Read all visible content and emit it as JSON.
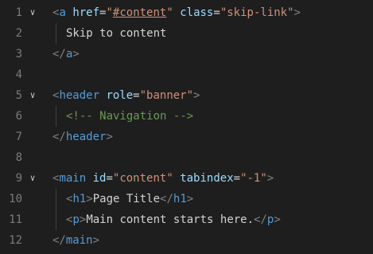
{
  "editor": {
    "colors": {
      "background": "#1e1e1e",
      "line_number": "#7b7b7b",
      "bracket": "#808080",
      "tag": "#569cd6",
      "attribute": "#9cdcfe",
      "string": "#ce9178",
      "text": "#d4d4d4",
      "comment": "#6a9955"
    },
    "fold_icon": "chevron-down-icon",
    "lines": [
      {
        "number": "1",
        "fold": "∨",
        "indent": 0,
        "tokens": [
          {
            "type": "bracket",
            "text": "<"
          },
          {
            "type": "tag",
            "text": "a"
          },
          {
            "type": "text",
            "text": " "
          },
          {
            "type": "attr",
            "text": "href"
          },
          {
            "type": "eq",
            "text": "="
          },
          {
            "type": "str",
            "text": "\""
          },
          {
            "type": "str_underline",
            "text": "#content"
          },
          {
            "type": "str",
            "text": "\""
          },
          {
            "type": "text",
            "text": " "
          },
          {
            "type": "attr",
            "text": "class"
          },
          {
            "type": "eq",
            "text": "="
          },
          {
            "type": "str",
            "text": "\"skip-link\""
          },
          {
            "type": "bracket",
            "text": ">"
          }
        ]
      },
      {
        "number": "2",
        "fold": "",
        "indent": 1,
        "tokens": [
          {
            "type": "text",
            "text": "Skip to content"
          }
        ]
      },
      {
        "number": "3",
        "fold": "",
        "indent": 0,
        "tokens": [
          {
            "type": "bracket",
            "text": "</"
          },
          {
            "type": "tag",
            "text": "a"
          },
          {
            "type": "bracket",
            "text": ">"
          }
        ]
      },
      {
        "number": "4",
        "fold": "",
        "indent": 0,
        "tokens": []
      },
      {
        "number": "5",
        "fold": "∨",
        "indent": 0,
        "tokens": [
          {
            "type": "bracket",
            "text": "<"
          },
          {
            "type": "tag",
            "text": "header"
          },
          {
            "type": "text",
            "text": " "
          },
          {
            "type": "attr",
            "text": "role"
          },
          {
            "type": "eq",
            "text": "="
          },
          {
            "type": "str",
            "text": "\"banner\""
          },
          {
            "type": "bracket",
            "text": ">"
          }
        ]
      },
      {
        "number": "6",
        "fold": "",
        "indent": 1,
        "tokens": [
          {
            "type": "comment",
            "text": "<!-- Navigation -->"
          }
        ]
      },
      {
        "number": "7",
        "fold": "",
        "indent": 0,
        "tokens": [
          {
            "type": "bracket",
            "text": "</"
          },
          {
            "type": "tag",
            "text": "header"
          },
          {
            "type": "bracket",
            "text": ">"
          }
        ]
      },
      {
        "number": "8",
        "fold": "",
        "indent": 0,
        "tokens": []
      },
      {
        "number": "9",
        "fold": "∨",
        "indent": 0,
        "tokens": [
          {
            "type": "bracket",
            "text": "<"
          },
          {
            "type": "tag",
            "text": "main"
          },
          {
            "type": "text",
            "text": " "
          },
          {
            "type": "attr",
            "text": "id"
          },
          {
            "type": "eq",
            "text": "="
          },
          {
            "type": "str",
            "text": "\"content\""
          },
          {
            "type": "text",
            "text": " "
          },
          {
            "type": "attr",
            "text": "tabindex"
          },
          {
            "type": "eq",
            "text": "="
          },
          {
            "type": "str",
            "text": "\"-1\""
          },
          {
            "type": "bracket",
            "text": ">"
          }
        ]
      },
      {
        "number": "10",
        "fold": "",
        "indent": 1,
        "tokens": [
          {
            "type": "bracket",
            "text": "<"
          },
          {
            "type": "tag",
            "text": "h1"
          },
          {
            "type": "bracket",
            "text": ">"
          },
          {
            "type": "text",
            "text": "Page Title"
          },
          {
            "type": "bracket",
            "text": "</"
          },
          {
            "type": "tag",
            "text": "h1"
          },
          {
            "type": "bracket",
            "text": ">"
          }
        ]
      },
      {
        "number": "11",
        "fold": "",
        "indent": 1,
        "tokens": [
          {
            "type": "bracket",
            "text": "<"
          },
          {
            "type": "tag",
            "text": "p"
          },
          {
            "type": "bracket",
            "text": ">"
          },
          {
            "type": "text",
            "text": "Main content starts here."
          },
          {
            "type": "bracket",
            "text": "</"
          },
          {
            "type": "tag",
            "text": "p"
          },
          {
            "type": "bracket",
            "text": ">"
          }
        ]
      },
      {
        "number": "12",
        "fold": "",
        "indent": 0,
        "tokens": [
          {
            "type": "bracket",
            "text": "</"
          },
          {
            "type": "tag",
            "text": "main"
          },
          {
            "type": "bracket",
            "text": ">"
          }
        ]
      }
    ]
  }
}
